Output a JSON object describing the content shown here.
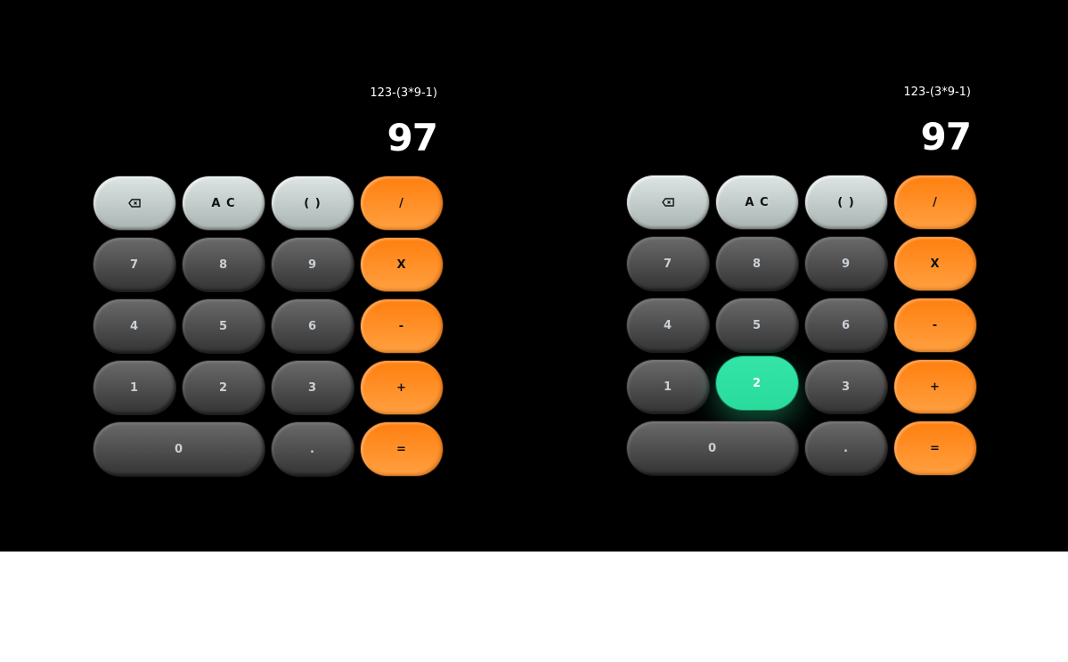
{
  "calculators": [
    {
      "expression": "123-(3*9-1)",
      "result": "97",
      "keys": {
        "backspace": "backspace-icon",
        "clear": "A C",
        "parens": "( )",
        "divide": "/",
        "seven": "7",
        "eight": "8",
        "nine": "9",
        "multiply": "X",
        "four": "4",
        "five": "5",
        "six": "6",
        "minus": "-",
        "one": "1",
        "two": "2",
        "three": "3",
        "plus": "+",
        "zero": "0",
        "dot": ".",
        "equals": "="
      }
    },
    {
      "expression": "123-(3*9-1)",
      "result": "97",
      "pressed_key": "2",
      "keys": {
        "backspace": "backspace-icon",
        "clear": "A C",
        "parens": "( )",
        "divide": "/",
        "seven": "7",
        "eight": "8",
        "nine": "9",
        "multiply": "X",
        "four": "4",
        "five": "5",
        "six": "6",
        "minus": "-",
        "one": "1",
        "two": "2",
        "three": "3",
        "plus": "+",
        "zero": "0",
        "dot": ".",
        "equals": "="
      }
    }
  ],
  "colors": {
    "background": "#000000",
    "operator": "#ff8a1f",
    "function": "#c6d0ce",
    "number": "#4a4a4a",
    "pressed": "#2fe0a0"
  }
}
